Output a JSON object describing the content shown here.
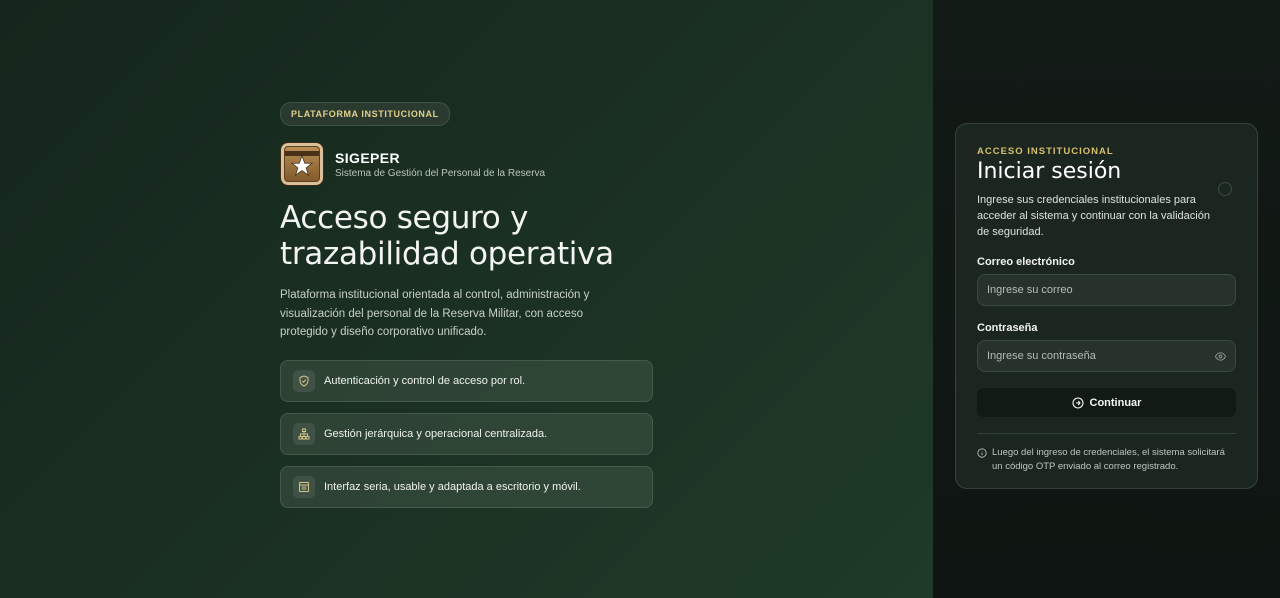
{
  "hero": {
    "badge": "PLATAFORMA INSTITUCIONAL",
    "brand_name": "SIGEPER",
    "brand_subtitle": "Sistema de Gestión del Personal de la Reserva",
    "headline_line1": "Acceso seguro y",
    "headline_line2": "trazabilidad operativa",
    "description": "Plataforma institucional orientada al control, administración y visualización del personal de la Reserva Militar, con acceso protegido y diseño corporativo unificado."
  },
  "features": [
    {
      "icon": "shield-icon",
      "label": "Autenticación y control de acceso por rol."
    },
    {
      "icon": "hierarchy-icon",
      "label": "Gestión jerárquica y operacional centralizada."
    },
    {
      "icon": "layout-icon",
      "label": "Interfaz seria, usable y adaptada a escritorio y móvil."
    }
  ],
  "login": {
    "eyebrow": "ACCESO INSTITUCIONAL",
    "title": "Iniciar sesión",
    "subtitle": "Ingrese sus credenciales institucionales para acceder al sistema y continuar con la validación de seguridad.",
    "email_label": "Correo electrónico",
    "email_placeholder": "Ingrese su correo",
    "password_label": "Contraseña",
    "password_placeholder": "Ingrese su contraseña",
    "submit_label": "Continuar",
    "note": "Luego del ingreso de credenciales, el sistema solicitará un código OTP enviado al correo registrado."
  },
  "colors": {
    "accent_gold": "#d8bf6e",
    "panel_green": "#1f3a28",
    "card_bg": "#1b2620"
  }
}
